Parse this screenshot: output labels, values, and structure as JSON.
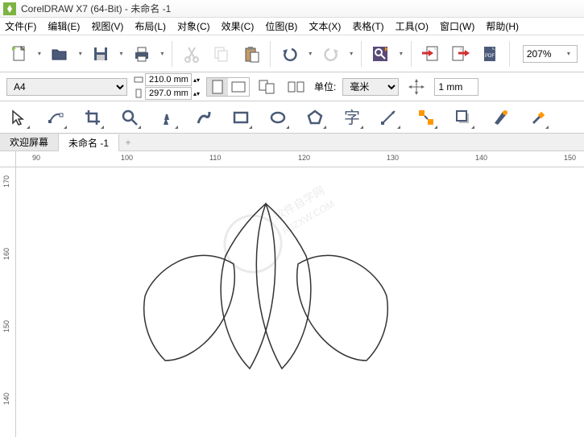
{
  "titlebar": {
    "title": "CorelDRAW X7 (64-Bit) - 未命名 -1"
  },
  "menu": {
    "file": "文件(F)",
    "edit": "编辑(E)",
    "view": "视图(V)",
    "layout": "布局(L)",
    "object": "对象(C)",
    "effect": "效果(C)",
    "bitmap": "位图(B)",
    "text": "文本(X)",
    "table": "表格(T)",
    "tools": "工具(O)",
    "window": "窗口(W)",
    "help": "帮助(H)"
  },
  "toolbar1": {
    "zoom": "207%"
  },
  "propbar": {
    "page_size": "A4",
    "width": "210.0 mm",
    "height": "297.0 mm",
    "unit_label": "单位:",
    "unit_value": "毫米",
    "nudge": "1 mm"
  },
  "tabs": {
    "welcome": "欢迎屏幕",
    "doc": "未命名 -1",
    "add": "+"
  },
  "ruler_h": [
    "90",
    "100",
    "110",
    "120",
    "130",
    "140",
    "150"
  ],
  "ruler_v": [
    "170",
    "160",
    "150",
    "140"
  ]
}
